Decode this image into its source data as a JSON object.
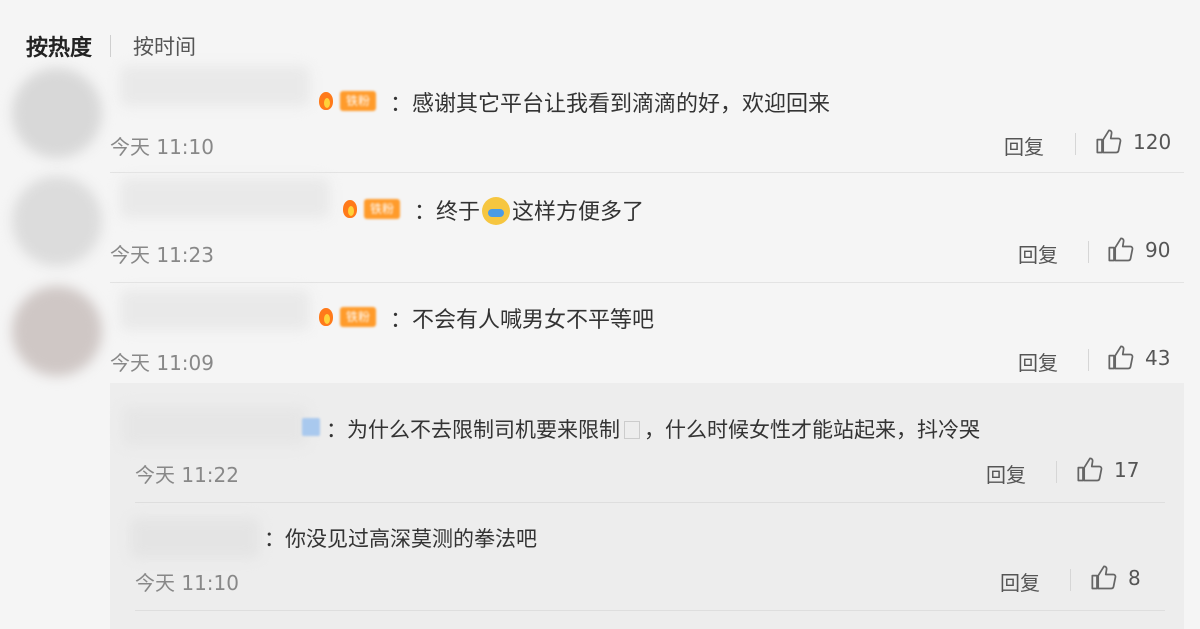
{
  "sort": {
    "hot_label": "按热度",
    "time_label": "按时间"
  },
  "comments": [
    {
      "content": "：感谢其它平台让我看到滴滴的好，欢迎回来",
      "time": "今天 11:10",
      "reply": "回复",
      "likes": "120"
    },
    {
      "content_before": "：终于",
      "content_after": "这样方便多了",
      "time": "今天 11:23",
      "reply": "回复",
      "likes": "90"
    },
    {
      "content": "：不会有人喊男女不平等吧",
      "time": "今天 11:09",
      "reply": "回复",
      "likes": "43"
    }
  ],
  "replies": [
    {
      "content": "：为什么不去限制司机要来限制",
      "content_after": "，什么时候女性才能站起来，抖冷哭",
      "time": "今天 11:22",
      "reply": "回复",
      "likes": "17"
    },
    {
      "content": "：你没见过高深莫测的拳法吧",
      "time": "今天 11:10",
      "reply": "回复",
      "likes": "8"
    }
  ],
  "colors": {
    "background": "#f5f5f5",
    "reply_box": "#ededed",
    "badge": "#ff9b2b"
  },
  "icons": {
    "like": "thumbs-up-icon",
    "badge": "fan-badge-icon",
    "emoji": "laughing-emoji-icon"
  }
}
